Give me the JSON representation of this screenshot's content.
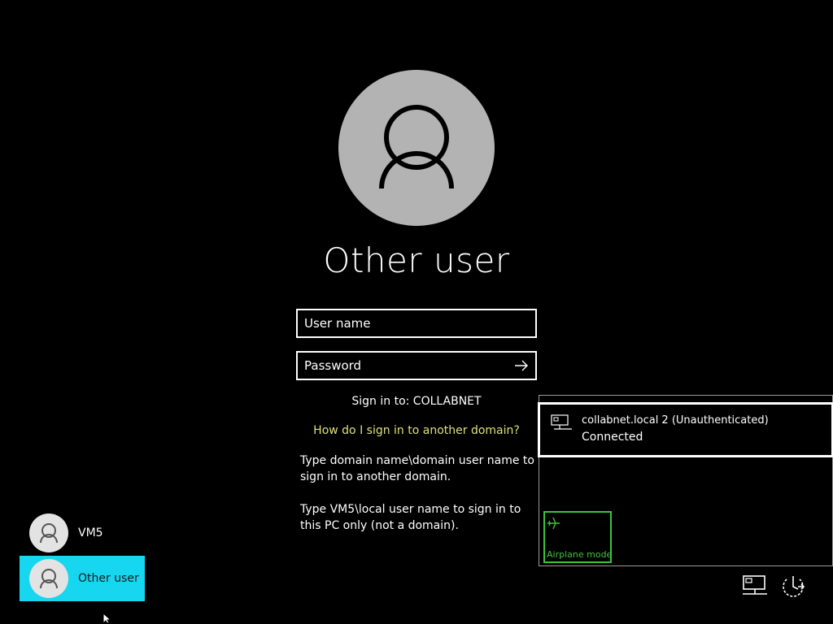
{
  "login": {
    "title": "Other user",
    "username_placeholder": "User name",
    "password_placeholder": "Password",
    "signin_to": "Sign in to: COLLABNET",
    "domain_link": "How do I sign in to another domain?",
    "help_domain": "Type domain name\\domain user name to sign in to another domain.",
    "help_local": "Type VM5\\local user name to sign in to this PC only (not a domain)."
  },
  "users": [
    {
      "label": "VM5"
    },
    {
      "label": "Other user",
      "selected": true
    }
  ],
  "network_flyout": {
    "network_name": "collabnet.local 2 (Unauthenticated)",
    "network_status": "Connected",
    "airplane_mode_label": "Airplane mode"
  },
  "tray": {
    "network_icon": "network-icon",
    "power_icon": "power-icon"
  },
  "colors": {
    "background": "#000000",
    "selected_tile": "#17d6ef",
    "link": "#dfe07a",
    "airplane": "#3cc43c",
    "avatar": "#b3b3b3"
  }
}
